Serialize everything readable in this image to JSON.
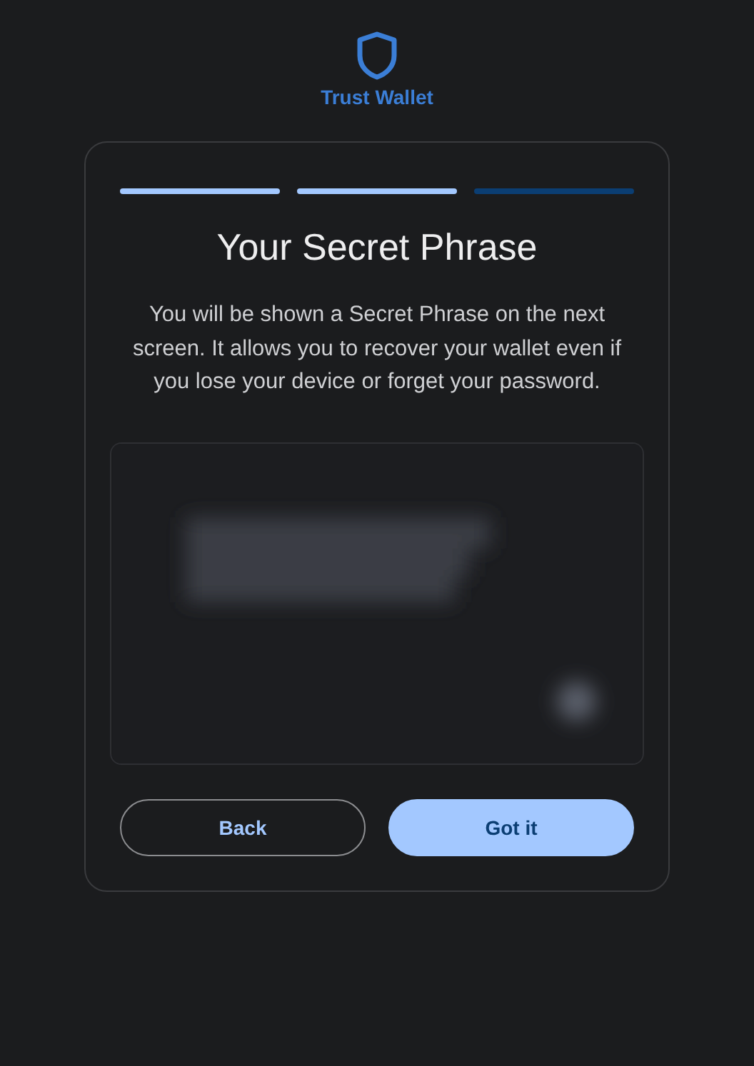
{
  "brand": {
    "name": "Trust Wallet"
  },
  "progress": [
    {
      "complete": true
    },
    {
      "complete": true
    },
    {
      "complete": false
    }
  ],
  "title": "Your Secret Phrase",
  "description": "You will be shown a Secret Phrase on the next screen. It allows you to recover your wallet even if you lose your device or forget your password.",
  "buttons": [
    {
      "label": "Back",
      "kind": "secondary"
    },
    {
      "label": "Got it",
      "kind": "primary"
    }
  ]
}
